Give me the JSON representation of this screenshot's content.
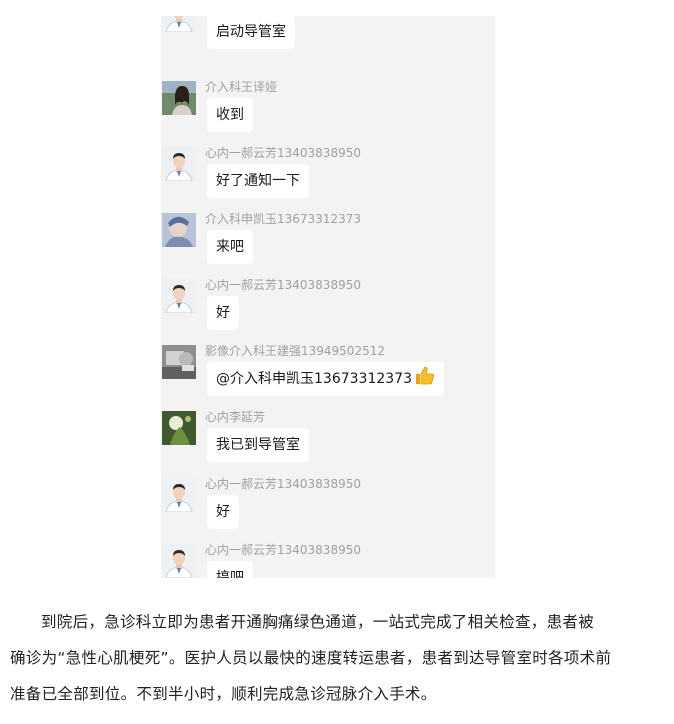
{
  "messages": [
    {
      "sender": "",
      "text": "启动导管室",
      "avatar": "doctor-avatar"
    },
    {
      "sender": "介入科王译娅",
      "text": "收到",
      "avatar": "woman-photo-avatar"
    },
    {
      "sender": "心内一郝云芳13403838950",
      "text": "好了通知一下",
      "avatar": "doctor-avatar"
    },
    {
      "sender": "介入科申凯玉13673312373",
      "text": "来吧",
      "avatar": "cartoon-avatar"
    },
    {
      "sender": "心内一郝云芳13403838950",
      "text": "好",
      "avatar": "doctor-avatar"
    },
    {
      "sender": "影像介入科王建强13949502512",
      "text": "@介入科申凯玉13673312373",
      "avatar": "equipment-photo-avatar",
      "emoji": "thumbs-up-icon"
    },
    {
      "sender": "心内李延芳",
      "text": "我已到导管室",
      "avatar": "plant-photo-avatar"
    },
    {
      "sender": "心内一郝云芳13403838950",
      "text": "好",
      "avatar": "doctor-avatar"
    },
    {
      "sender": "心内一郝云芳13403838950",
      "text": "搞吧",
      "avatar": "doctor-avatar"
    }
  ],
  "caption": {
    "line1": "到院后，急诊科立即为患者开通胸痛绿色通道，一站式完成了相关检查，患者被",
    "line2": "确诊为“急性心肌梗死”。医护人员以最快的速度转运患者，患者到达导管室时各项术前",
    "line3": "准备已全部到位。不到半小时，顺利完成急诊冠脉介入手术。"
  },
  "colors": {
    "chat_bg": "#f3f3f3",
    "bubble_bg": "#ffffff",
    "sender_text": "#a0a0a0"
  }
}
